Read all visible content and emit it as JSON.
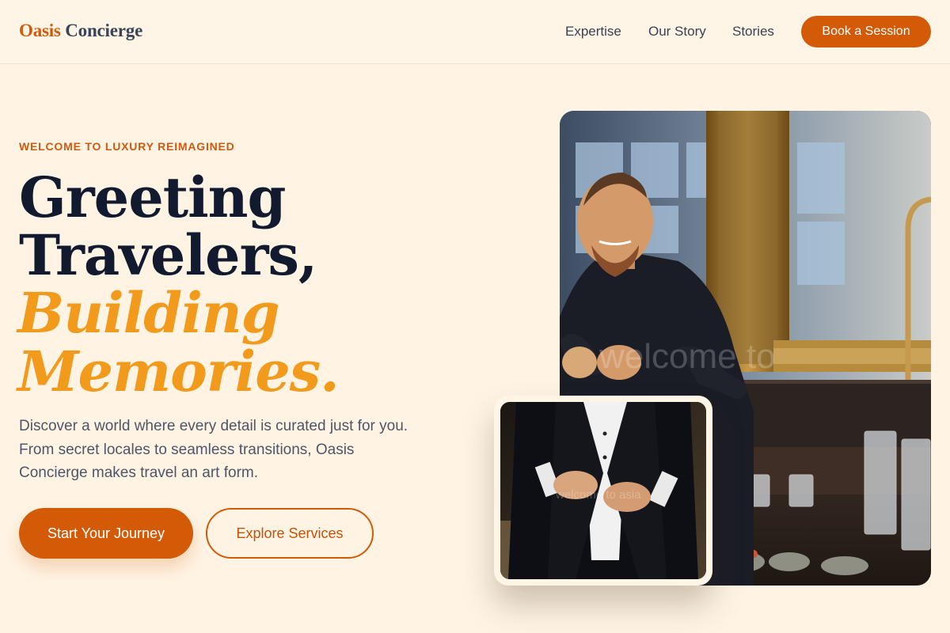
{
  "header": {
    "brand_first": "Oasis",
    "brand_second": "Concierge",
    "nav": [
      "Expertise",
      "Our Story",
      "Stories"
    ],
    "cta": "Book a Session"
  },
  "hero": {
    "eyebrow": "WELCOME TO LUXURY REIMAGINED",
    "heading_line1": "Greeting",
    "heading_line2": "Travelers,",
    "heading_accent1": "Building",
    "heading_accent2": "Memories.",
    "description": "Discover a world where every detail is curated just for you. From secret locales to seamless transitions, Oasis Concierge makes travel an art form.",
    "primary_cta": "Start Your Journey",
    "secondary_cta": "Explore Services"
  },
  "colors": {
    "background": "#fff4e4",
    "accent": "#d35a07",
    "highlight": "#f19a1c",
    "heading": "#111a2e"
  },
  "images": {
    "main": "smiling-bartender-photo",
    "inset": "man-buttoning-tuxedo-photo"
  }
}
